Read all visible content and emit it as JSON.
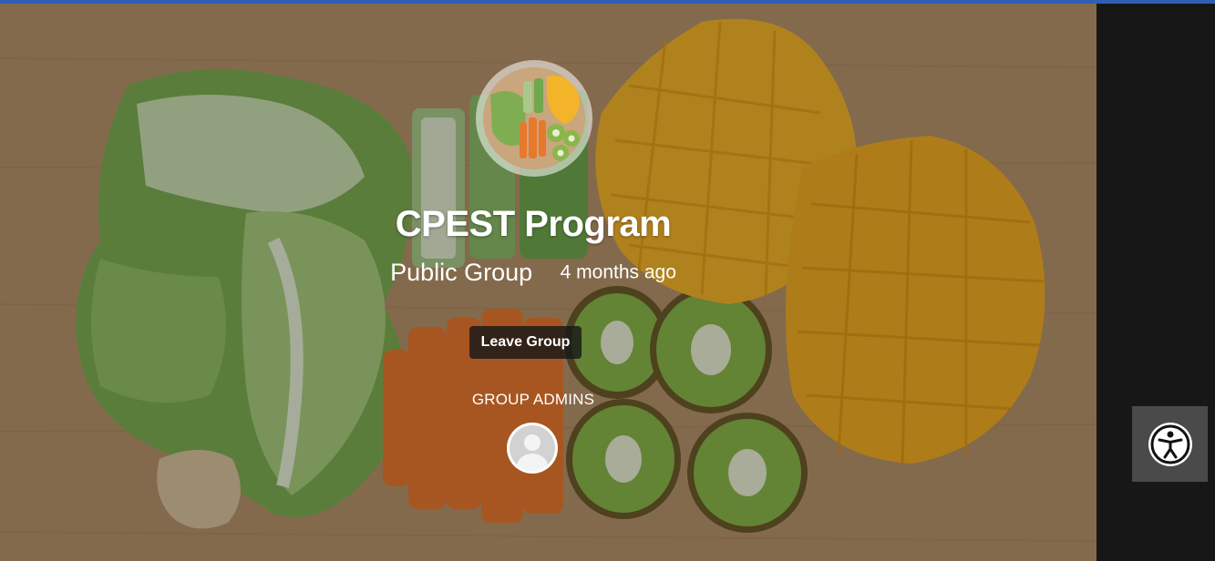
{
  "group": {
    "title": "CPEST Program",
    "type": "Public Group",
    "last_active": "4 months ago",
    "leave_label": "Leave Group",
    "admins_label": "GROUP ADMINS"
  },
  "icons": {
    "accessibility": "accessibility-icon",
    "admin_avatar": "default-user-avatar"
  },
  "colors": {
    "topbar": "#2f5fb3",
    "button_bg": "#181818",
    "accessibility_bg": "#4a4a4a"
  }
}
